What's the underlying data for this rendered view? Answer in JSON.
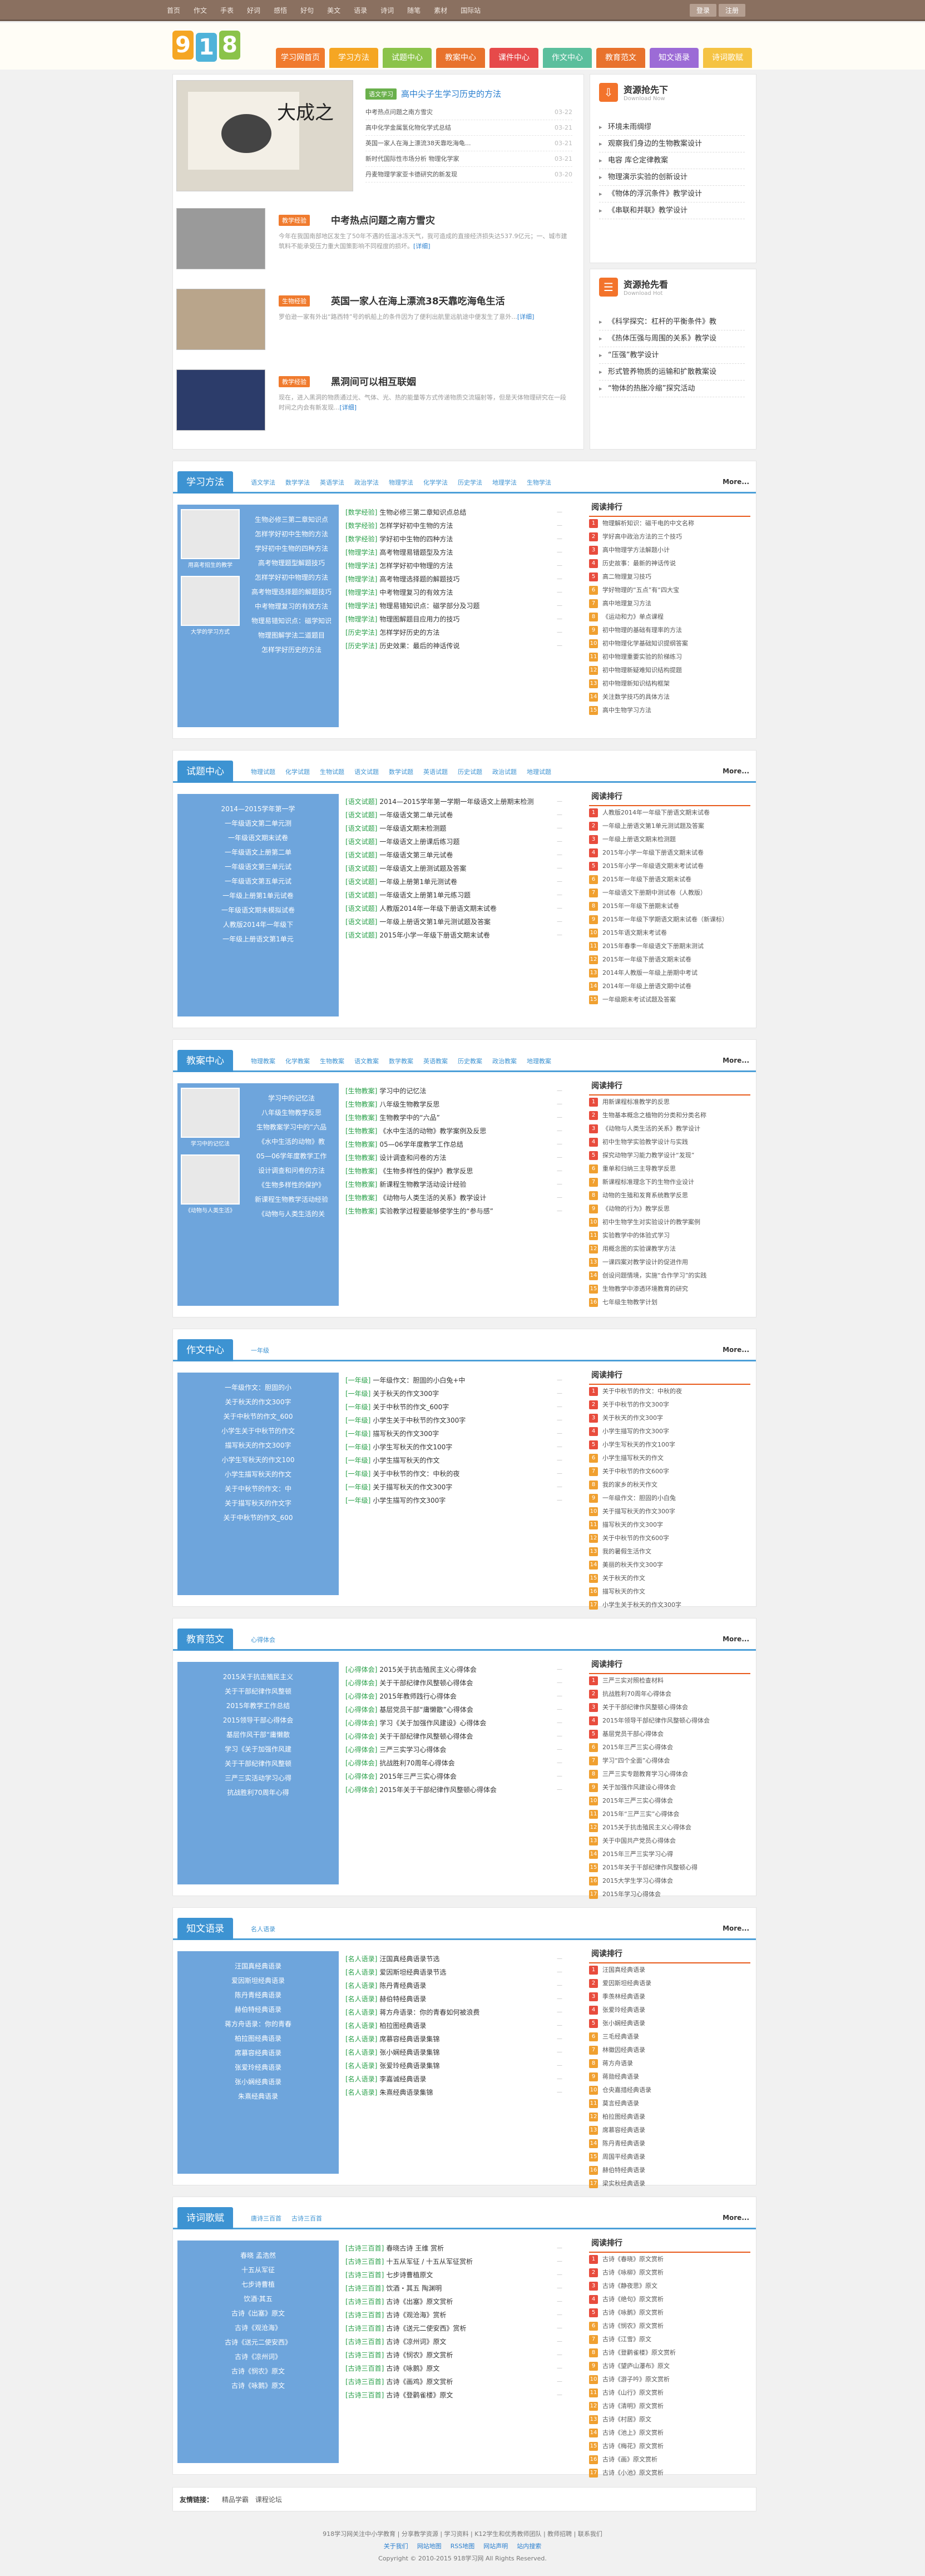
{
  "topbar": {
    "nav": [
      "首页",
      "作文",
      "手表",
      "好词",
      "感悟",
      "好句",
      "美文",
      "语录",
      "诗词",
      "随笔",
      "素材",
      "国际站"
    ],
    "login": "登录",
    "register": "注册"
  },
  "logo": {
    "chars": [
      "9",
      "1",
      "8"
    ]
  },
  "mainnav": [
    {
      "label": "学习网首页",
      "color": "#f07b2e"
    },
    {
      "label": "学习方法",
      "color": "#f5a623"
    },
    {
      "label": "试题中心",
      "color": "#8bc34a"
    },
    {
      "label": "教案中心",
      "color": "#e8722c"
    },
    {
      "label": "课件中心",
      "color": "#e64a4a"
    },
    {
      "label": "作文中心",
      "color": "#5bbf9c"
    },
    {
      "label": "教育范文",
      "color": "#e8722c"
    },
    {
      "label": "知文语录",
      "color": "#9c6bd6"
    },
    {
      "label": "诗词歌赋",
      "color": "#f5c342"
    }
  ],
  "feature": {
    "tag": "语文学习",
    "title": "高中尖子生学习历史的方法",
    "list": [
      {
        "t": "中考热点问题之南方雪灾",
        "d": "03-22"
      },
      {
        "t": "高中化学金属氢化物化学式总结",
        "d": "03-21"
      },
      {
        "t": "英国一家人在海上漂流38天靠吃海龟...",
        "d": "03-21"
      },
      {
        "t": "新时代国际性市场分析 物理化学家",
        "d": "03-21"
      },
      {
        "t": "丹麦物理学家亚卡德研究的新发现",
        "d": "03-20"
      }
    ]
  },
  "news": [
    {
      "tag": "教学经验",
      "title": "中考热点问题之南方雪灾",
      "desc": "今年在我国南部地区发生了50年不遇的低温冰冻天气，我可造成的直接经济损失达537.9亿元；一、城市建筑料不能承受压力重大国策影响不同程度的损坏。",
      "more": "[详细]"
    },
    {
      "tag": "生物经验",
      "title": "英国一家人在海上漂流38天靠吃海龟生活",
      "desc": "罗伯逊一家有外出“路西特”号的帆船上的条件因为了便利出航里远航途中便发生了意外...",
      "more": "[详细]"
    },
    {
      "tag": "教学经验",
      "title": "黑洞间可以相互联姻",
      "desc": "现在，进入黑洞的物质通过光、气体、光、热的能量等方式传递物质交流辐射等，但是天体物理研究在一段时间之内会有新发现...",
      "more": "[详细]"
    }
  ],
  "side1": {
    "title": "资源抢先下",
    "sub": "Download Now",
    "list": [
      "环境未雨绸缪",
      "观察我们身边的生物教案设计",
      "电容  库仑定律教案",
      "物理演示实验的创新设计",
      "《物体的浮沉条件》教学设计",
      "《串联和并联》教学设计"
    ]
  },
  "side2": {
    "title": "资源抢先看",
    "sub": "Download Hot",
    "list": [
      "《科学探究：杠杆的平衡条件》教",
      "《热体压强与周围的关系》教学设",
      "“压强”教学设计",
      "形式管养物质的运输和扩散教案设",
      "“物体的热胀冷缩”探究活动"
    ]
  },
  "sections": [
    {
      "title": "学习方法",
      "sub": [
        "语文学法",
        "数学学法",
        "英语学法",
        "政治学法",
        "物理学法",
        "化学学法",
        "历史学法",
        "地理学法",
        "生物学法"
      ],
      "more": "More...",
      "box": [
        "生物必修三第二章知识点",
        "怎样学好初中生物的方法",
        "学好初中生物的四种方法",
        "高考物理题型解题技巧",
        "怎样学好初中物理的方法",
        "高考物理选择题的解题技巧",
        "中考物理复习的有效方法",
        "物理易错知识点：磁学知识",
        "物理图解学法二道题目",
        "怎样学好历史的方法"
      ],
      "box_caption": [
        "用高考招生的教学",
        "大学的学习方式"
      ],
      "list": [
        [
          "[数学经验]",
          "生物必修三第二章知识点总结"
        ],
        [
          "[数学经验]",
          "怎样学好初中生物的方法"
        ],
        [
          "[数学经验]",
          "学好初中生物的四种方法"
        ],
        [
          "[物理学法]",
          "高考物理易错题型及方法"
        ],
        [
          "[物理学法]",
          "怎样学好初中物理的方法"
        ],
        [
          "[物理学法]",
          "高考物理选择题的解题技巧"
        ],
        [
          "[物理学法]",
          "中考物理复习的有效方法"
        ],
        [
          "[物理学法]",
          "物理易错知识点：磁学部分及习题"
        ],
        [
          "[物理学法]",
          "物理图解题目应用力的技巧"
        ],
        [
          "[历史学法]",
          "怎样学好历史的方法"
        ],
        [
          "[历史学法]",
          "历史效果：最后的神话传说"
        ]
      ],
      "rank": [
        "物理解析知识：磁干电的中文名称",
        "学好高中政治方法的三个技巧",
        "高中物理学方法解题小计",
        "历史故事：最新的神话传说",
        "高二物理复习技巧",
        "学好物理的“五点”有“四大宝",
        "高中地理复习方法",
        "《运动和力》单点课程",
        "初中物理的基础有理率的方法",
        "初中物理化学基础知识提纲答案",
        "初中物理重要实验的阶梯练习",
        "初中物理新疑难知识结构提题",
        "初中物理新知识结构框架",
        "关注数学技巧的具体方法",
        "高中生物学习方法"
      ]
    },
    {
      "title": "试题中心",
      "sub": [
        "物理试题",
        "化学试题",
        "生物试题",
        "语文试题",
        "数学试题",
        "英语试题",
        "历史试题",
        "政治试题",
        "地理试题"
      ],
      "more": "More...",
      "box": [
        "2014—2015学年第一学",
        "一年级语文第二单元测",
        "一年级语文期末试卷",
        "一年级语文上册第二单",
        "一年级语文第三单元试",
        "一年级语文第五单元试",
        "一年级上册第1单元试卷",
        "一年级语文期末模拟试卷",
        "人教版2014年一年级下",
        "一年级上册语文第1单元"
      ],
      "list": [
        [
          "[语文试题]",
          "2014—2015学年第一学期一年级语文上册期末检测"
        ],
        [
          "[语文试题]",
          "一年级语文第二单元试卷"
        ],
        [
          "[语文试题]",
          "一年级语文期末检测题"
        ],
        [
          "[语文试题]",
          "一年级语文上册课后练习题"
        ],
        [
          "[语文试题]",
          "一年级语文第三单元试卷"
        ],
        [
          "[语文试题]",
          "一年级语文上册测试题及答案"
        ],
        [
          "[语文试题]",
          "一年级上册第1单元测试卷"
        ],
        [
          "[语文试题]",
          "一年级语文上册第1单元练习题"
        ],
        [
          "[语文试题]",
          "人教版2014年一年级下册语文期末试卷"
        ],
        [
          "[语文试题]",
          "一年级上册语文第1单元测试题及答案"
        ],
        [
          "[语文试题]",
          "2015年小学一年级下册语文期末试卷"
        ]
      ],
      "rank": [
        "人教版2014年一年级下册语文期末试卷",
        "一年级上册语文第1单元测试题及答案",
        "一年级上册语文期末检测题",
        "2015年小学一年级下册语文期末试卷",
        "2015年小学一年级语文期末考试试卷",
        "2015年一年级下册语文期末试卷",
        "一年级语文下册期中测试卷（人教版）",
        "2015年一年级下册期末试卷",
        "2015年一年级下学期语文期末试卷（新课标）",
        "2015年语文期末考试卷",
        "2015年春季一年级语文下册期末测试",
        "2015年一年级下册语文期末试卷",
        "2014年人教版一年级上册期中考试",
        "2014年一年级上册语文期中试卷",
        "一年级期末考试试题及答案"
      ]
    },
    {
      "title": "教案中心",
      "sub": [
        "物理教案",
        "化学教案",
        "生物教案",
        "语文教案",
        "数学教案",
        "英语教案",
        "历史教案",
        "政治教案",
        "地理教案"
      ],
      "more": "More...",
      "box": [
        "学习中的记忆法",
        "八年级生物教学反思",
        "生物教案学习中的“六品",
        "《水中生活的动物》教",
        "05—06学年度教学工作",
        "设计调查和问卷的方法",
        "《生物多样性的保护》",
        "新课程生物教学活动经验",
        "《动物与人类生活的关"
      ],
      "box_caption": [
        "学习中的记忆法",
        "《动物与人类生活》"
      ],
      "list": [
        [
          "[生物教案]",
          "学习中的记忆法"
        ],
        [
          "[生物教案]",
          "八年级生物教学反思"
        ],
        [
          "[生物教案]",
          "生物教学中的“六品”"
        ],
        [
          "[生物教案]",
          "《水中生活的动物》教学案例及反思"
        ],
        [
          "[生物教案]",
          "05—06学年度教学工作总结"
        ],
        [
          "[生物教案]",
          "设计调查和问卷的方法"
        ],
        [
          "[生物教案]",
          "《生物多样性的保护》教学反思"
        ],
        [
          "[生物教案]",
          "新课程生物教学活动设计经验"
        ],
        [
          "[生物教案]",
          "《动物与人类生活的关系》教学设计"
        ],
        [
          "[生物教案]",
          "实验教学过程要能够使学生的“参与感”"
        ]
      ],
      "rank": [
        "用新课程标准教学的反思",
        "生物基本概念之植物的分类和分类名称",
        "《动物与人类生活的关系》教学设计",
        "初中生物学实验教学设计与实践",
        "探究动物学习能力教学设计“发现”",
        "重单和归纳三主导教学反思",
        "新课程标准理念下的生物作业设计",
        "动物的生殖和发育系统教学反思",
        "《动物的行为》教学反思",
        "初中生物学生对实验设计的教学案例",
        "实验教学中的体验式学习",
        "用概念图的实验课教学方法",
        "一课四案对教学设计的促进作用",
        "创设问题情境，实施“合作学习”的实践",
        "生物教学中渗透环境教育的研究",
        "七年级生物教学计划"
      ]
    },
    {
      "title": "作文中心",
      "sub": [
        "一年级"
      ],
      "more": "More...",
      "box": [
        "一年级作文：胆固的小",
        "关于秋天的作文300字",
        "关于中秋节的作文_600",
        "小学生关于中秋节的作文",
        "描写秋天的作文300字",
        "小学生写秋天的作文100",
        "小学生描写秋天的作文",
        "关于中秋节的作文：中",
        "关于描写秋天的作文字",
        "关于中秋节的作文_600"
      ],
      "list": [
        [
          "[一年级]",
          "一年级作文：胆固的小白兔+中"
        ],
        [
          "[一年级]",
          "关于秋天的作文300字"
        ],
        [
          "[一年级]",
          "关于中秋节的作文_600字"
        ],
        [
          "[一年级]",
          "小学生关于中秋节的作文300字"
        ],
        [
          "[一年级]",
          "描写秋天的作文300字"
        ],
        [
          "[一年级]",
          "小学生写秋天的作文100字"
        ],
        [
          "[一年级]",
          "小学生描写秋天的作文"
        ],
        [
          "[一年级]",
          "关于中秋节的作文：中秋的夜"
        ],
        [
          "[一年级]",
          "关于描写秋天的作文300字"
        ],
        [
          "[一年级]",
          "小学生描写的作文300字"
        ]
      ],
      "rank": [
        "关于中秋节的作文：中秋的夜",
        "关于中秋节的作文300字",
        "关于秋天的作文300字",
        "小学生描写的作文300字",
        "小学生写秋天的作文100字",
        "小学生描写秋天的作文",
        "关于中秋节的作文600字",
        "我的家乡的秋天作文",
        "一年级作文：胆固的小白兔",
        "关于描写秋天的作文300字",
        "描写秋天的作文300字",
        "关于中秋节的作文600字",
        "我的暑假生活作文",
        "美丽的秋天作文300字",
        "关于秋天的作文",
        "描写秋天的作文",
        "小学生关于秋天的作文300字"
      ]
    },
    {
      "title": "教育范文",
      "sub": [
        "心得体会"
      ],
      "more": "More...",
      "box": [
        "2015关于抗击殖民主义",
        "关于干部纪律作风整顿",
        "2015年教学工作总结",
        "2015领导干部心得体会",
        "基层作风干部“庸懒散",
        "学习《关于加强作风建",
        "关于干部纪律作风整顿",
        "三严三实活动学习心得",
        "抗战胜利70周年心得"
      ],
      "list": [
        [
          "[心得体会]",
          "2015关于抗击殖民主义心得体会"
        ],
        [
          "[心得体会]",
          "关于干部纪律作风整顿心得体会"
        ],
        [
          "[心得体会]",
          "2015年教师践行心得体会"
        ],
        [
          "[心得体会]",
          "基层党员干部“庸懒散”心得体会"
        ],
        [
          "[心得体会]",
          "学习《关于加强作风建设》心得体会"
        ],
        [
          "[心得体会]",
          "关于干部纪律作风整顿心得体会"
        ],
        [
          "[心得体会]",
          "三严三实学习心得体会"
        ],
        [
          "[心得体会]",
          "抗战胜利70周年心得体会"
        ],
        [
          "[心得体会]",
          "2015年三严三实心得体会"
        ],
        [
          "[心得体会]",
          "2015年关于干部纪律作风整顿心得体会"
        ]
      ],
      "rank": [
        "三严三实对照检查材料",
        "抗战胜利70周年心得体会",
        "关于干部纪律作风整顿心得体会",
        "2015年领导干部纪律作风整顿心得体会",
        "基层党员干部心得体会",
        "2015年三严三实心得体会",
        "学习“四个全面”心得体会",
        "三严三实专题教育学习心得体会",
        "关于加强作风建设心得体会",
        "2015年三严三实心得体会",
        "2015年“三严三实”心得体会",
        "2015关于抗击殖民主义心得体会",
        "关于中国共产党员心得体会",
        "2015年三严三实学习心得",
        "2015年关于干部纪律作风整顿心得",
        "2015大学生学习心得体会",
        "2015年学习心得体会"
      ]
    },
    {
      "title": "知文语录",
      "sub": [
        "名人语录"
      ],
      "more": "More...",
      "box": [
        "汪国真经典语录",
        "爱因斯坦经典语录",
        "陈丹青经典语录",
        "赫伯特经典语录",
        "蒋方舟语录：你的青春",
        "柏拉图经典语录",
        "席慕容经典语录",
        "张爱玲经典语录",
        "张小娴经典语录",
        "朱熹经典语录"
      ],
      "list": [
        [
          "[名人语录]",
          "汪国真经典语录节选"
        ],
        [
          "[名人语录]",
          "爱因斯坦经典语录节选"
        ],
        [
          "[名人语录]",
          "陈丹青经典语录"
        ],
        [
          "[名人语录]",
          "赫伯特经典语录"
        ],
        [
          "[名人语录]",
          "蒋方舟语录：你的青春如何被浪费"
        ],
        [
          "[名人语录]",
          "柏拉图经典语录"
        ],
        [
          "[名人语录]",
          "席慕容经典语录集锦"
        ],
        [
          "[名人语录]",
          "张小娴经典语录集锦"
        ],
        [
          "[名人语录]",
          "张爱玲经典语录集锦"
        ],
        [
          "[名人语录]",
          "李嘉诚经典语录"
        ],
        [
          "[名人语录]",
          "朱熹经典语录集锦"
        ]
      ],
      "rank": [
        "汪国真经典语录",
        "爱因斯坦经典语录",
        "季羡林经典语录",
        "张爱玲经典语录",
        "张小娴经典语录",
        "三毛经典语录",
        "林徽因经典语录",
        "蒋方舟语录",
        "蒋勋经典语录",
        "仓央嘉措经典语录",
        "莫言经典语录",
        "柏拉图经典语录",
        "席慕容经典语录",
        "陈丹青经典语录",
        "周国平经典语录",
        "赫伯特经典语录",
        "梁实秋经典语录"
      ]
    },
    {
      "title": "诗词歌赋",
      "sub": [
        "唐诗三百首",
        "古诗三百首"
      ],
      "more": "More...",
      "box": [
        "春晓 孟浩然",
        "十五从军征",
        "七步诗曹植",
        "饮酒·其五",
        "古诗《出塞》原文",
        "古诗《观沧海》",
        "古诗《送元二使安西》",
        "古诗《凉州词》",
        "古诗《悯农》原文",
        "古诗《咏鹅》原文"
      ],
      "list": [
        [
          "[古诗三百首]",
          "春晓古诗 王维 赏析"
        ],
        [
          "[古诗三百首]",
          "十五从军征 / 十五从军征赏析"
        ],
        [
          "[古诗三百首]",
          "七步诗曹植原文"
        ],
        [
          "[古诗三百首]",
          "饮酒・其五 陶渊明"
        ],
        [
          "[古诗三百首]",
          "古诗《出塞》原文赏析"
        ],
        [
          "[古诗三百首]",
          "古诗《观沧海》赏析"
        ],
        [
          "[古诗三百首]",
          "古诗《送元二使安西》赏析"
        ],
        [
          "[古诗三百首]",
          "古诗《凉州词》原文"
        ],
        [
          "[古诗三百首]",
          "古诗《悯农》原文赏析"
        ],
        [
          "[古诗三百首]",
          "古诗《咏鹅》原文"
        ],
        [
          "[古诗三百首]",
          "古诗《画鸡》原文赏析"
        ],
        [
          "[古诗三百首]",
          "古诗《登鹳雀楼》原文"
        ]
      ],
      "rank": [
        "古诗《春晓》原文赏析",
        "古诗《咏柳》原文赏析",
        "古诗《静夜思》原文",
        "古诗《绝句》原文赏析",
        "古诗《咏鹅》原文赏析",
        "古诗《悯农》原文赏析",
        "古诗《江雪》原文",
        "古诗《登鹳雀楼》原文赏析",
        "古诗《望庐山瀑布》原文",
        "古诗《游子吟》原文赏析",
        "古诗《山行》原文赏析",
        "古诗《清明》原文赏析",
        "古诗《村居》原文",
        "古诗《池上》原文赏析",
        "古诗《梅花》原文赏析",
        "古诗《画》原文赏析",
        "古诗《小池》原文赏析"
      ]
    }
  ],
  "rank_heading": "阅读排行",
  "rank_colors": [
    "#e84c3d",
    "#f0a030"
  ],
  "friend_links": {
    "label": "友情链接：",
    "items": [
      "精品学霸",
      "课程论坛"
    ]
  },
  "footer": {
    "line1": "918学习网关注中小学教育 | 分享教学资源 | 学习资料 | K12学生和优秀教师团队 | 教师招聘 | 联系我们",
    "line2": [
      "关于我们",
      "网站地图",
      "RSS地图",
      "网站声明",
      "站内搜索"
    ],
    "line3": "Copyright © 2010-2015 918学习网 All Rights Reserved."
  }
}
